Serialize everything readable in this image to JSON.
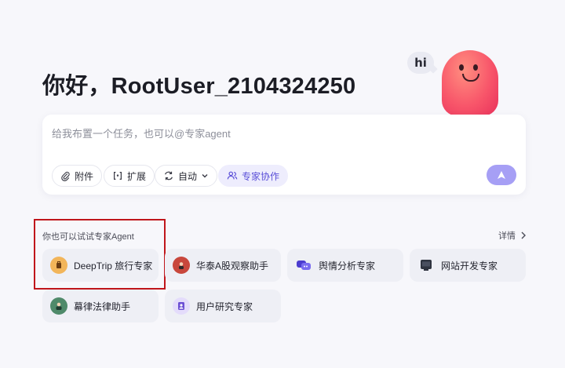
{
  "greeting": "你好，RootUser_2104324250",
  "mascot": {
    "bubble_text": "hi"
  },
  "input": {
    "placeholder": "给我布置一个任务，也可以@专家agent",
    "chips": [
      {
        "label": "附件",
        "icon": "paperclip-icon"
      },
      {
        "label": "扩展",
        "icon": "extension-icon"
      },
      {
        "label": "自动",
        "icon": "auto-mode-icon",
        "dropdown": true
      },
      {
        "label": "专家协作",
        "icon": "users-icon",
        "active": true
      }
    ],
    "send_icon": "send-arrow-icon"
  },
  "suggestions": {
    "title": "你也可以试试专家Agent",
    "details_label": "详情",
    "agents": [
      {
        "label": "DeepTrip 旅行专家",
        "icon": "travel-avatar-icon",
        "color": "#f2b55a"
      },
      {
        "label": "华泰A股观察助手",
        "icon": "stock-avatar-icon",
        "color": "#c8473c"
      },
      {
        "label": "舆情分析专家",
        "icon": "sentiment-analysis-icon",
        "color": "#4b3ccf"
      },
      {
        "label": "网站开发专家",
        "icon": "web-dev-icon",
        "color": "#2f3440"
      },
      {
        "label": "幕律法律助手",
        "icon": "law-avatar-icon",
        "color": "#4f8a6a"
      },
      {
        "label": "用户研究专家",
        "icon": "user-research-icon",
        "color": "#6c4fd4"
      }
    ]
  },
  "colors": {
    "accent": "#5a4fd8",
    "send_button": "#a69ff5",
    "highlight": "#c0161b",
    "background": "#f7f7fb"
  }
}
